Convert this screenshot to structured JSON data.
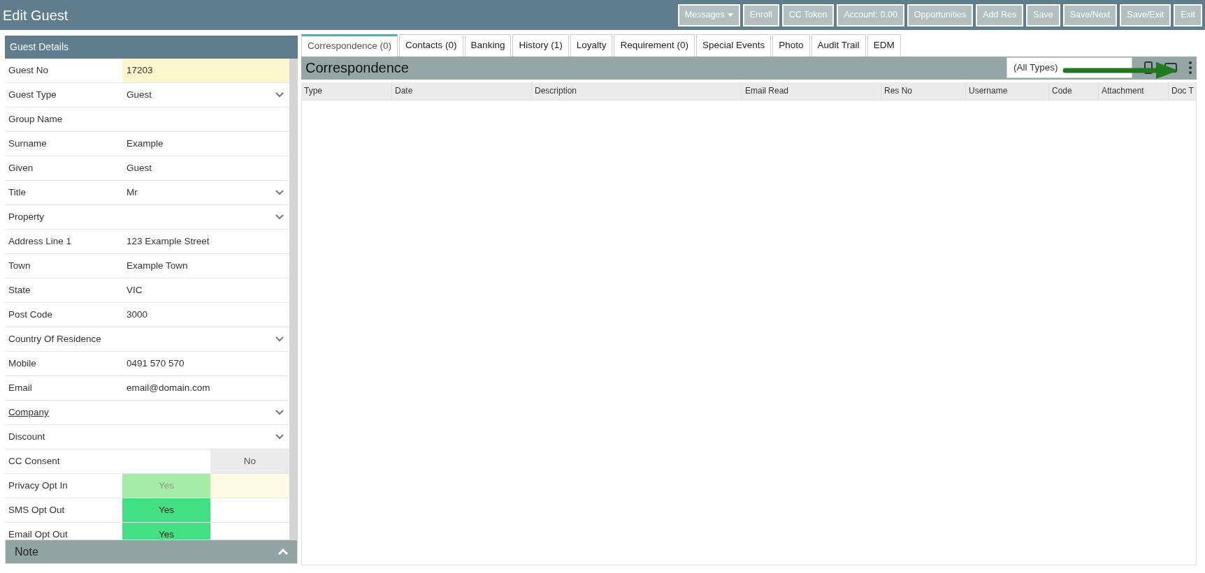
{
  "window": {
    "title": "Edit Guest"
  },
  "toolbar": [
    {
      "label": "Messages",
      "kind": "dropdown"
    },
    {
      "label": "Enroll",
      "kind": "button"
    },
    {
      "label": "CC Token",
      "kind": "button"
    },
    {
      "label": "Account: 0.00",
      "kind": "button"
    },
    {
      "label": "Opportunities",
      "kind": "button"
    },
    {
      "label": "Add Res",
      "kind": "button"
    },
    {
      "label": "Save",
      "kind": "button"
    },
    {
      "label": "Save/Next",
      "kind": "button"
    },
    {
      "label": "Save/Exit",
      "kind": "button"
    },
    {
      "label": "Exit",
      "kind": "button"
    }
  ],
  "guest_details": {
    "title": "Guest Details",
    "fields": [
      {
        "label": "Guest No",
        "kind": "readonly",
        "value": "17203"
      },
      {
        "label": "Guest Type",
        "kind": "select",
        "value": "Guest"
      },
      {
        "label": "Group Name",
        "kind": "text"
      },
      {
        "label": "Surname",
        "kind": "text",
        "value": "Example"
      },
      {
        "label": "Given",
        "kind": "text",
        "value": "Guest"
      },
      {
        "label": "Title",
        "kind": "select",
        "value": "Mr"
      },
      {
        "label": "Property",
        "kind": "select"
      },
      {
        "label": "Address Line 1",
        "kind": "text",
        "value": "123 Example Street"
      },
      {
        "label": "Town",
        "kind": "text",
        "value": "Example Town"
      },
      {
        "label": "State",
        "kind": "text",
        "value": "VIC"
      },
      {
        "label": "Post Code",
        "kind": "text",
        "value": "3000"
      },
      {
        "label": "Country Of Residence",
        "kind": "select"
      },
      {
        "label": "Mobile",
        "kind": "text",
        "value": "0491 570 570"
      },
      {
        "label": "Email",
        "kind": "text",
        "value": "email@domain.com"
      },
      {
        "label": "Company",
        "kind": "select",
        "link": true
      },
      {
        "label": "Discount",
        "kind": "select"
      },
      {
        "label": "CC Consent",
        "kind": "toggle",
        "yes_selected": false,
        "value": "No",
        "disabled": false
      },
      {
        "label": "Privacy Opt In",
        "kind": "toggle",
        "yes_selected": true,
        "value": "Yes",
        "disabled": true
      },
      {
        "label": "SMS Opt Out",
        "kind": "toggle",
        "yes_selected": true,
        "value": "Yes",
        "disabled": false
      },
      {
        "label": "Email Opt Out",
        "kind": "toggle",
        "yes_selected": true,
        "value": "Yes",
        "disabled": false
      }
    ]
  },
  "note": {
    "title": "Note",
    "expanded": false
  },
  "tabs": [
    {
      "label": "Correspondence (0)",
      "selected": true
    },
    {
      "label": "Contacts (0)",
      "selected": false
    },
    {
      "label": "Banking",
      "selected": false
    },
    {
      "label": "History (1)",
      "selected": false
    },
    {
      "label": "Loyalty",
      "selected": false
    },
    {
      "label": "Requirement (0)",
      "selected": false
    },
    {
      "label": "Special Events",
      "selected": false
    },
    {
      "label": "Photo",
      "selected": false
    },
    {
      "label": "Audit Trail",
      "selected": false
    },
    {
      "label": "EDM",
      "selected": false
    }
  ],
  "correspondence": {
    "title": "Correspondence",
    "filter": "(All Types)",
    "columns": [
      "Type",
      "Date",
      "Description",
      "Email Read",
      "Res No",
      "Username",
      "Code",
      "Attachment",
      "Doc T"
    ]
  }
}
